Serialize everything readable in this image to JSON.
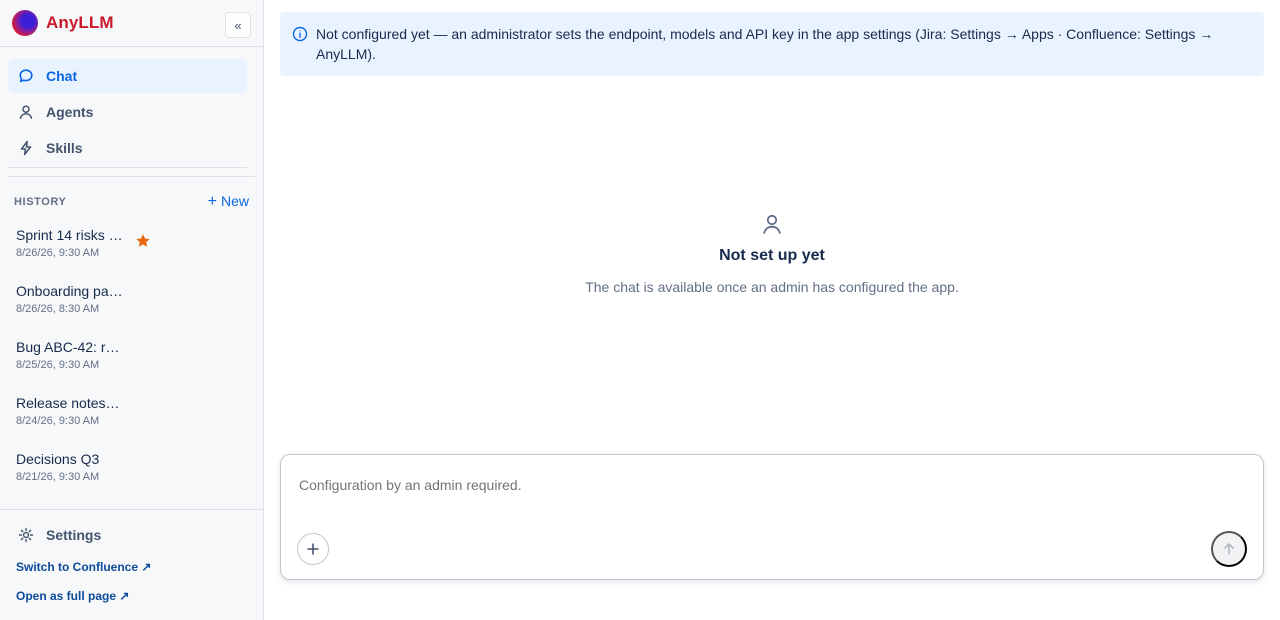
{
  "brand": {
    "name": "AnyLLM",
    "collapse_glyph": "«"
  },
  "nav": {
    "items": [
      {
        "label": "Chat",
        "icon": "chat-bubble-icon",
        "active": true
      },
      {
        "label": "Agents",
        "icon": "person-icon",
        "active": false
      },
      {
        "label": "Skills",
        "icon": "lightning-icon",
        "active": false
      }
    ]
  },
  "history": {
    "title": "HISTORY",
    "new_label": "New",
    "items": [
      {
        "title": "Sprint 14 risks …",
        "date": "8/26/26, 9:30 AM",
        "starred": true
      },
      {
        "title": "Onboarding pa…",
        "date": "8/26/26, 8:30 AM",
        "starred": false
      },
      {
        "title": "Bug ABC-42: r…",
        "date": "8/25/26, 9:30 AM",
        "starred": false
      },
      {
        "title": "Release notes…",
        "date": "8/24/26, 9:30 AM",
        "starred": false
      },
      {
        "title": "Decisions Q3",
        "date": "8/21/26, 9:30 AM",
        "starred": false
      }
    ]
  },
  "footer": {
    "settings_label": "Settings",
    "switch_link": "Switch to Confluence ↗",
    "open_link": "Open as full page ↗"
  },
  "banner": {
    "text": "Not configured yet — an administrator sets the endpoint, models and API key in the app settings (Jira: Settings → Apps · Confluence: Settings → AnyLLM)."
  },
  "empty_state": {
    "title": "Not set up yet",
    "description": "The chat is available once an admin has configured the app."
  },
  "composer": {
    "placeholder": "Configuration by an admin required."
  },
  "colors": {
    "brand": "#c9172b",
    "accent": "#0c66e4",
    "star": "#e56910"
  }
}
